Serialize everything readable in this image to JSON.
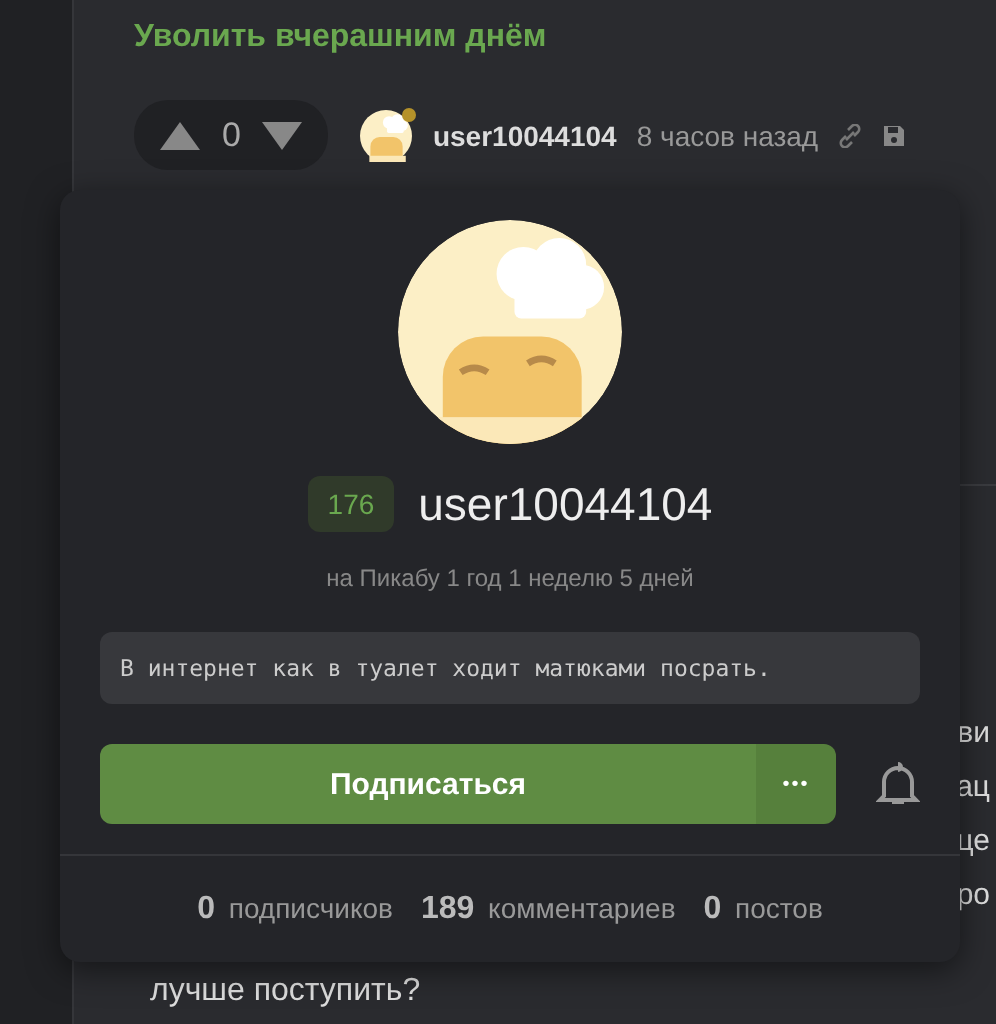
{
  "post": {
    "title": "Уволить вчерашним днём"
  },
  "comment": {
    "rating": "0",
    "author": "user10044104",
    "online": true,
    "time": "8 часов назад"
  },
  "background_text": [
    "ви",
    "ац",
    "це",
    "ро"
  ],
  "background_last_line": "лучше поступить?",
  "profile_card": {
    "rating": "176",
    "username": "user10044104",
    "member_since": "на Пикабу 1 год 1 неделю 5 дней",
    "about": "В интернет как в туалет ходит матюками посрать.",
    "subscribe_button": "Подписаться",
    "more_button": "•••",
    "stats": [
      "**0** подписчиков",
      "**189** комментариев",
      "**0** постов"
    ]
  }
}
